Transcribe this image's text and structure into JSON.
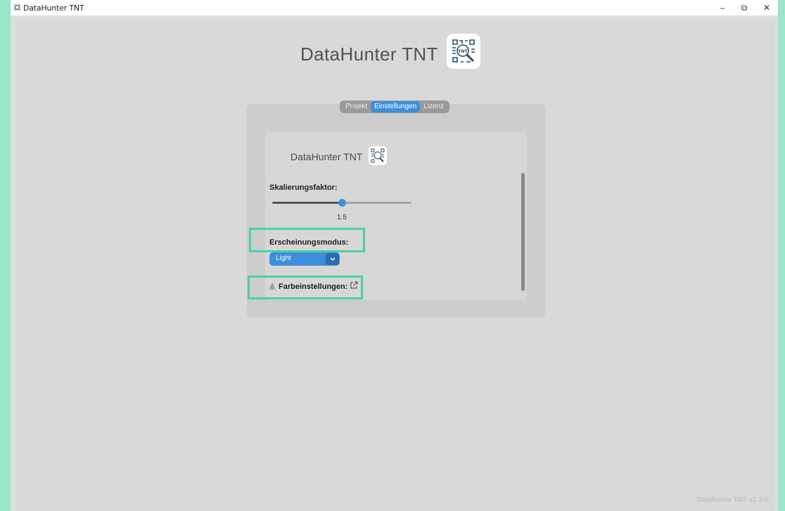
{
  "window": {
    "title": "DataHunter TNT",
    "controls": {
      "minimize": "–",
      "maximize": "⧉",
      "close": "✕"
    }
  },
  "app": {
    "title": "DataHunter TNT",
    "version": "Datahunter TNT v1.3.6"
  },
  "tabs": [
    {
      "label": "Projekt",
      "active": false
    },
    {
      "label": "Einstellungen",
      "active": true
    },
    {
      "label": "Lizenz",
      "active": false
    }
  ],
  "settings": {
    "header_title": "DataHunter TNT",
    "scale_label": "Skalierungsfaktor:",
    "scale_value": "1.5",
    "scale_fraction": 0.5,
    "appearance_label": "Erscheinungsmodus:",
    "appearance_value": "Light",
    "color_settings_label": "Farbeinstellungen:"
  },
  "colors": {
    "accent": "#3d8fdc",
    "highlight": "#4dd0a3",
    "backdrop": "#99e6c9"
  }
}
